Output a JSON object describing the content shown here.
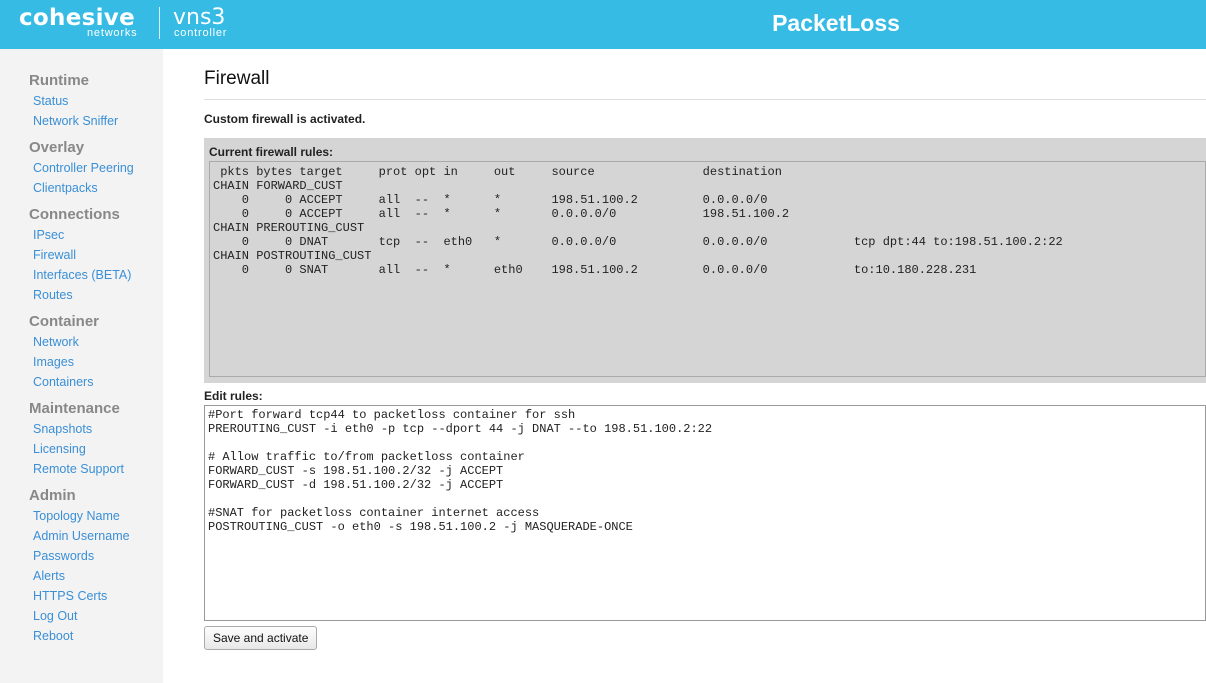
{
  "header": {
    "brand": "cohesive",
    "brand_sub": "networks",
    "product": "vns3",
    "product_sub": "controller",
    "title": "PacketLoss",
    "background_color": "#35bbe4"
  },
  "sidebar": {
    "groups": [
      {
        "heading": "Runtime",
        "items": [
          "Status",
          "Network Sniffer"
        ]
      },
      {
        "heading": "Overlay",
        "items": [
          "Controller Peering",
          "Clientpacks"
        ]
      },
      {
        "heading": "Connections",
        "items": [
          "IPsec",
          "Firewall",
          "Interfaces (BETA)",
          "Routes"
        ]
      },
      {
        "heading": "Container",
        "items": [
          "Network",
          "Images",
          "Containers"
        ]
      },
      {
        "heading": "Maintenance",
        "items": [
          "Snapshots",
          "Licensing",
          "Remote Support"
        ]
      },
      {
        "heading": "Admin",
        "items": [
          "Topology Name",
          "Admin Username",
          "Passwords",
          "Alerts",
          "HTTPS Certs",
          "Log Out",
          "Reboot"
        ]
      }
    ],
    "link_color": "#3a8fd6",
    "heading_color": "#888888"
  },
  "main": {
    "title": "Firewall",
    "status": "Custom firewall is activated.",
    "current_rules_label": "Current firewall rules:",
    "current_rules_text": " pkts bytes target     prot opt in     out     source               destination\nCHAIN FORWARD_CUST\n    0     0 ACCEPT     all  --  *      *       198.51.100.2         0.0.0.0/0\n    0     0 ACCEPT     all  --  *      *       0.0.0.0/0            198.51.100.2\nCHAIN PREROUTING_CUST\n    0     0 DNAT       tcp  --  eth0   *       0.0.0.0/0            0.0.0.0/0            tcp dpt:44 to:198.51.100.2:22\nCHAIN POSTROUTING_CUST\n    0     0 SNAT       all  --  *      eth0    198.51.100.2         0.0.0.0/0            to:10.180.228.231",
    "edit_rules_label": "Edit rules:",
    "edit_rules_value": "#Port forward tcp44 to packetloss container for ssh\nPREROUTING_CUST -i eth0 -p tcp --dport 44 -j DNAT --to 198.51.100.2:22\n\n# Allow traffic to/from packetloss container\nFORWARD_CUST -s 198.51.100.2/32 -j ACCEPT\nFORWARD_CUST -d 198.51.100.2/32 -j ACCEPT\n\n#SNAT for packetloss container internet access\nPOSTROUTING_CUST -o eth0 -s 198.51.100.2 -j MASQUERADE-ONCE",
    "save_button": "Save and activate"
  }
}
